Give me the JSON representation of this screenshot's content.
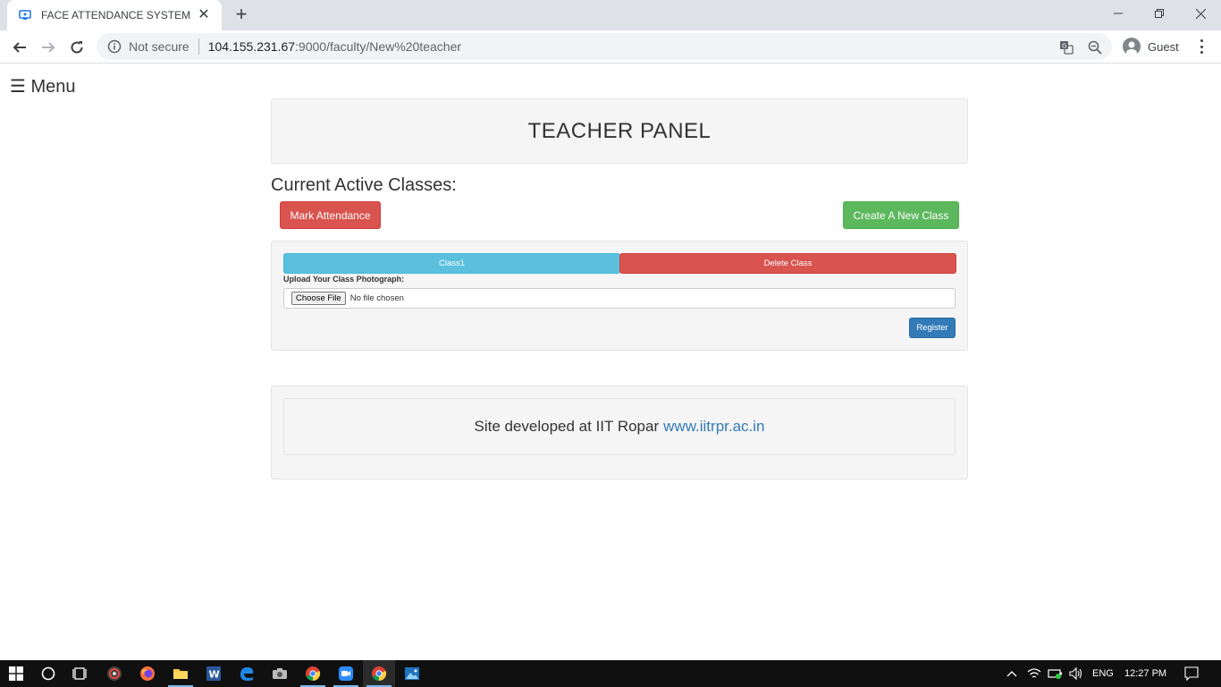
{
  "browser": {
    "tab_title": "FACE ATTENDANCE SYSTEM",
    "security_label": "Not secure",
    "url_host": "104.155.231.67",
    "url_rest": ":9000/faculty/New%20teacher",
    "profile_label": "Guest"
  },
  "page": {
    "menu_label": "☰ Menu",
    "panel_title": "TEACHER PANEL",
    "section_title": "Current Active Classes:",
    "mark_attendance_label": "Mark Attendance",
    "create_class_label": "Create A New Class",
    "classes": [
      {
        "name": "Class1",
        "delete_label": "Delete Class",
        "upload_label": "Upload Your Class Photograph:",
        "file_button_label": "Choose File",
        "file_status": "No file chosen",
        "register_label": "Register"
      }
    ],
    "footer_text": "Site developed at IIT Ropar",
    "footer_link": "www.iitrpr.ac.in"
  },
  "taskbar": {
    "language": "ENG",
    "time": "12:27 PM",
    "apps": [
      "start-icon",
      "search-icon",
      "task-view-icon",
      "media-app-icon",
      "firefox-icon",
      "file-explorer-icon",
      "word-icon",
      "edge-icon",
      "camera-app-icon",
      "chrome-icon",
      "zoom-icon",
      "chrome-active-icon",
      "photos-icon"
    ]
  },
  "colors": {
    "danger": "#d9534f",
    "success": "#5cb85c",
    "info": "#5bc0de",
    "primary": "#337ab7",
    "well": "#f5f5f5",
    "link": "#337ab7"
  }
}
